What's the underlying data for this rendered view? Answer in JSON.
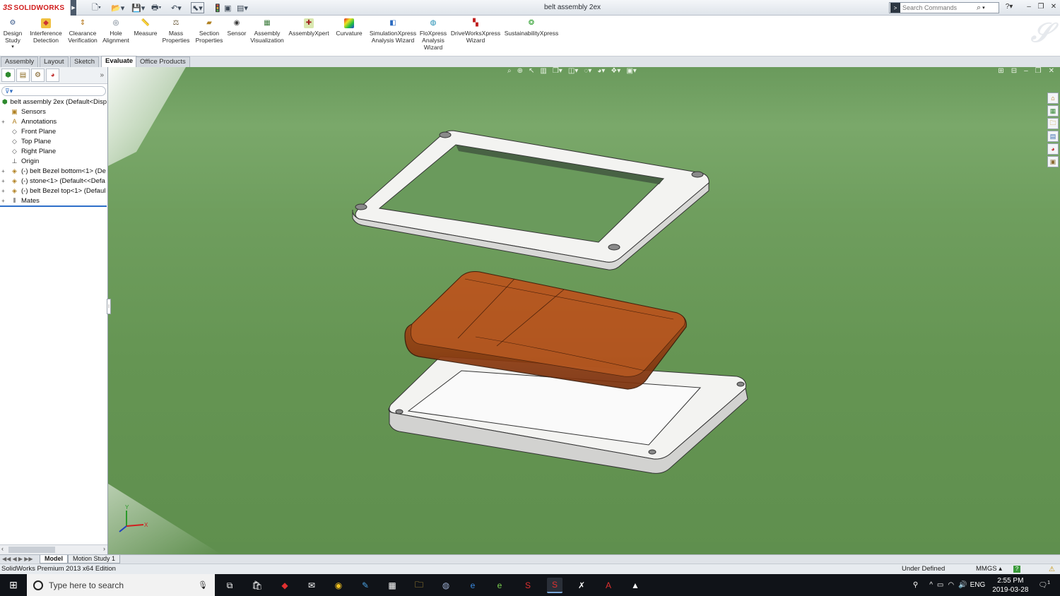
{
  "app": {
    "brand": "SOLIDWORKS",
    "brand_mark": "3S",
    "document_title": "belt assembly 2ex"
  },
  "search": {
    "placeholder": "Search Commands"
  },
  "ribbon": {
    "buttons": [
      {
        "label": "Design Study",
        "icon": "design-study-icon"
      },
      {
        "label": "Interference Detection",
        "icon": "interference-icon"
      },
      {
        "label": "Clearance Verification",
        "icon": "clearance-icon"
      },
      {
        "label": "Hole Alignment",
        "icon": "hole-alignment-icon"
      },
      {
        "label": "Measure",
        "icon": "measure-icon"
      },
      {
        "label": "Mass Properties",
        "icon": "mass-properties-icon"
      },
      {
        "label": "Section Properties",
        "icon": "section-properties-icon"
      },
      {
        "label": "Sensor",
        "icon": "sensor-icon"
      },
      {
        "label": "Assembly Visualization",
        "icon": "assembly-visualization-icon"
      },
      {
        "label": "AssemblyXpert",
        "icon": "assemblyxpert-icon"
      },
      {
        "label": "Curvature",
        "icon": "curvature-icon"
      },
      {
        "label": "SimulationXpress Analysis Wizard",
        "icon": "simulationxpress-icon"
      },
      {
        "label": "FloXpress Analysis Wizard",
        "icon": "floxpress-icon"
      },
      {
        "label": "DriveWorksXpress Wizard",
        "icon": "driveworksxpress-icon"
      },
      {
        "label": "SustainabilityXpress",
        "icon": "sustainabilityxpress-icon"
      }
    ]
  },
  "tabs": [
    "Assembly",
    "Layout",
    "Sketch",
    "Evaluate",
    "Office Products"
  ],
  "active_tab": "Evaluate",
  "tree": {
    "items": [
      {
        "label": "belt assembly 2ex  (Default<Disp",
        "icon": "assembly-icon",
        "expand": ""
      },
      {
        "label": "Sensors",
        "icon": "sensors-icon",
        "expand": ""
      },
      {
        "label": "Annotations",
        "icon": "annotations-icon",
        "expand": "+"
      },
      {
        "label": "Front Plane",
        "icon": "plane-icon",
        "expand": ""
      },
      {
        "label": "Top Plane",
        "icon": "plane-icon",
        "expand": ""
      },
      {
        "label": "Right Plane",
        "icon": "plane-icon",
        "expand": ""
      },
      {
        "label": "Origin",
        "icon": "origin-icon",
        "expand": ""
      },
      {
        "label": "(-) belt Bezel bottom<1> (De",
        "icon": "part-icon",
        "expand": "+"
      },
      {
        "label": "(-) stone<1> (Default<<Defa",
        "icon": "part-icon",
        "expand": "+"
      },
      {
        "label": "(-) belt Bezel top<1> (Defaul",
        "icon": "part-icon",
        "expand": "+"
      },
      {
        "label": "Mates",
        "icon": "mates-icon",
        "expand": "+"
      }
    ]
  },
  "bottom_tabs": [
    "Model",
    "Motion Study 1"
  ],
  "status": {
    "edition": "SolidWorks Premium 2013 x64 Edition",
    "state": "Under Defined",
    "units": "MMGS"
  },
  "taskbar": {
    "search_placeholder": "Type here to search",
    "language": "ENG",
    "time": "2:55 PM",
    "date": "2019-03-28",
    "notifications": "1"
  },
  "colors": {
    "viewport_green": "#6a9a5c",
    "brand_red": "#d01c1c",
    "stone_brown": "#8a3a10",
    "bezel_white": "#f4f4f2"
  }
}
